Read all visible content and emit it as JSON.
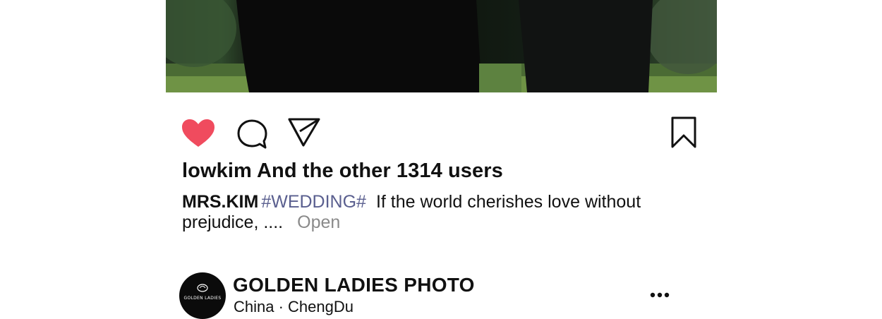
{
  "post": {
    "photo": {
      "alt": "wedding photo"
    },
    "actions": {
      "like_icon": "heart-icon",
      "comment_icon": "comment-icon",
      "share_icon": "send-icon",
      "save_icon": "bookmark-icon",
      "liked": true,
      "like_color": "#f04b5e"
    },
    "likes_text": "lowkim And the other 1314 users",
    "caption": {
      "username": "MRS.KIM",
      "hashtag": "#WEDDING#",
      "text": "If the world cherishes love without prejudice, ....",
      "more_label": "Open"
    }
  },
  "account": {
    "avatar_text": "GOLDEN LADIES",
    "name": "GOLDEN LADIES PHOTO",
    "location": "China · ChengDu",
    "menu_icon": "more-options-icon"
  }
}
